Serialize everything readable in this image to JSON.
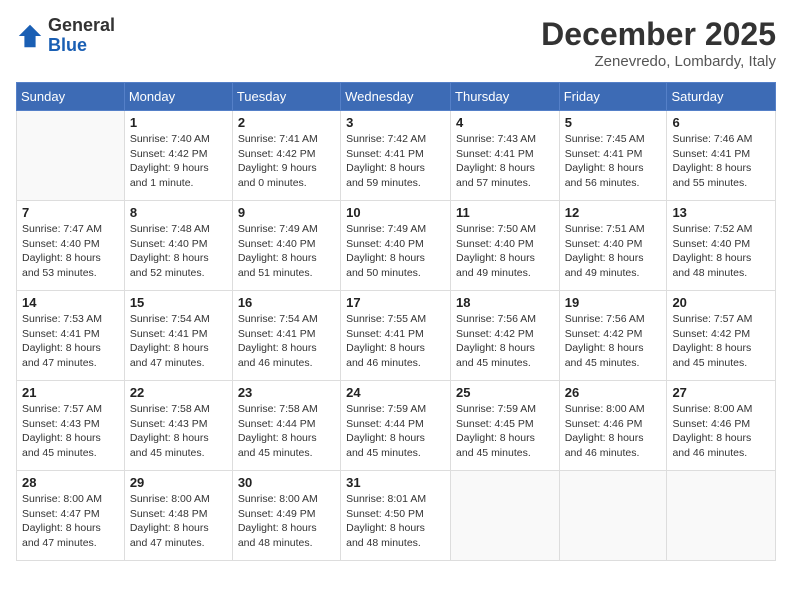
{
  "header": {
    "logo_general": "General",
    "logo_blue": "Blue",
    "month_title": "December 2025",
    "location": "Zenevredo, Lombardy, Italy"
  },
  "days_of_week": [
    "Sunday",
    "Monday",
    "Tuesday",
    "Wednesday",
    "Thursday",
    "Friday",
    "Saturday"
  ],
  "weeks": [
    [
      {
        "day": "",
        "info": ""
      },
      {
        "day": "1",
        "info": "Sunrise: 7:40 AM\nSunset: 4:42 PM\nDaylight: 9 hours\nand 1 minute."
      },
      {
        "day": "2",
        "info": "Sunrise: 7:41 AM\nSunset: 4:42 PM\nDaylight: 9 hours\nand 0 minutes."
      },
      {
        "day": "3",
        "info": "Sunrise: 7:42 AM\nSunset: 4:41 PM\nDaylight: 8 hours\nand 59 minutes."
      },
      {
        "day": "4",
        "info": "Sunrise: 7:43 AM\nSunset: 4:41 PM\nDaylight: 8 hours\nand 57 minutes."
      },
      {
        "day": "5",
        "info": "Sunrise: 7:45 AM\nSunset: 4:41 PM\nDaylight: 8 hours\nand 56 minutes."
      },
      {
        "day": "6",
        "info": "Sunrise: 7:46 AM\nSunset: 4:41 PM\nDaylight: 8 hours\nand 55 minutes."
      }
    ],
    [
      {
        "day": "7",
        "info": "Sunrise: 7:47 AM\nSunset: 4:40 PM\nDaylight: 8 hours\nand 53 minutes."
      },
      {
        "day": "8",
        "info": "Sunrise: 7:48 AM\nSunset: 4:40 PM\nDaylight: 8 hours\nand 52 minutes."
      },
      {
        "day": "9",
        "info": "Sunrise: 7:49 AM\nSunset: 4:40 PM\nDaylight: 8 hours\nand 51 minutes."
      },
      {
        "day": "10",
        "info": "Sunrise: 7:49 AM\nSunset: 4:40 PM\nDaylight: 8 hours\nand 50 minutes."
      },
      {
        "day": "11",
        "info": "Sunrise: 7:50 AM\nSunset: 4:40 PM\nDaylight: 8 hours\nand 49 minutes."
      },
      {
        "day": "12",
        "info": "Sunrise: 7:51 AM\nSunset: 4:40 PM\nDaylight: 8 hours\nand 49 minutes."
      },
      {
        "day": "13",
        "info": "Sunrise: 7:52 AM\nSunset: 4:40 PM\nDaylight: 8 hours\nand 48 minutes."
      }
    ],
    [
      {
        "day": "14",
        "info": "Sunrise: 7:53 AM\nSunset: 4:41 PM\nDaylight: 8 hours\nand 47 minutes."
      },
      {
        "day": "15",
        "info": "Sunrise: 7:54 AM\nSunset: 4:41 PM\nDaylight: 8 hours\nand 47 minutes."
      },
      {
        "day": "16",
        "info": "Sunrise: 7:54 AM\nSunset: 4:41 PM\nDaylight: 8 hours\nand 46 minutes."
      },
      {
        "day": "17",
        "info": "Sunrise: 7:55 AM\nSunset: 4:41 PM\nDaylight: 8 hours\nand 46 minutes."
      },
      {
        "day": "18",
        "info": "Sunrise: 7:56 AM\nSunset: 4:42 PM\nDaylight: 8 hours\nand 45 minutes."
      },
      {
        "day": "19",
        "info": "Sunrise: 7:56 AM\nSunset: 4:42 PM\nDaylight: 8 hours\nand 45 minutes."
      },
      {
        "day": "20",
        "info": "Sunrise: 7:57 AM\nSunset: 4:42 PM\nDaylight: 8 hours\nand 45 minutes."
      }
    ],
    [
      {
        "day": "21",
        "info": "Sunrise: 7:57 AM\nSunset: 4:43 PM\nDaylight: 8 hours\nand 45 minutes."
      },
      {
        "day": "22",
        "info": "Sunrise: 7:58 AM\nSunset: 4:43 PM\nDaylight: 8 hours\nand 45 minutes."
      },
      {
        "day": "23",
        "info": "Sunrise: 7:58 AM\nSunset: 4:44 PM\nDaylight: 8 hours\nand 45 minutes."
      },
      {
        "day": "24",
        "info": "Sunrise: 7:59 AM\nSunset: 4:44 PM\nDaylight: 8 hours\nand 45 minutes."
      },
      {
        "day": "25",
        "info": "Sunrise: 7:59 AM\nSunset: 4:45 PM\nDaylight: 8 hours\nand 45 minutes."
      },
      {
        "day": "26",
        "info": "Sunrise: 8:00 AM\nSunset: 4:46 PM\nDaylight: 8 hours\nand 46 minutes."
      },
      {
        "day": "27",
        "info": "Sunrise: 8:00 AM\nSunset: 4:46 PM\nDaylight: 8 hours\nand 46 minutes."
      }
    ],
    [
      {
        "day": "28",
        "info": "Sunrise: 8:00 AM\nSunset: 4:47 PM\nDaylight: 8 hours\nand 47 minutes."
      },
      {
        "day": "29",
        "info": "Sunrise: 8:00 AM\nSunset: 4:48 PM\nDaylight: 8 hours\nand 47 minutes."
      },
      {
        "day": "30",
        "info": "Sunrise: 8:00 AM\nSunset: 4:49 PM\nDaylight: 8 hours\nand 48 minutes."
      },
      {
        "day": "31",
        "info": "Sunrise: 8:01 AM\nSunset: 4:50 PM\nDaylight: 8 hours\nand 48 minutes."
      },
      {
        "day": "",
        "info": ""
      },
      {
        "day": "",
        "info": ""
      },
      {
        "day": "",
        "info": ""
      }
    ]
  ]
}
